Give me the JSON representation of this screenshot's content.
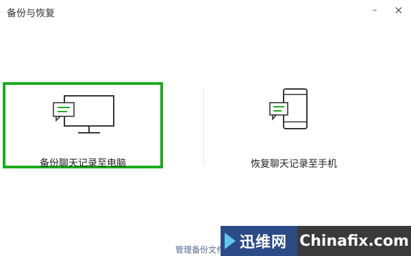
{
  "window": {
    "title": "备份与恢复",
    "minimize_glyph": "–",
    "close_glyph": "×"
  },
  "options": {
    "backup": {
      "label": "备份聊天记录至电脑",
      "icon": "monitor-chat-icon",
      "selected": true
    },
    "restore": {
      "label": "恢复聊天记录至手机",
      "icon": "phone-chat-icon",
      "selected": false
    }
  },
  "footer": {
    "manage_link": "管理备份文件"
  },
  "watermark": {
    "cn_text": "迅维网",
    "en_text": "Chinafix.com"
  },
  "colors": {
    "accent_green": "#1aad19",
    "link_blue": "#576b95",
    "watermark_blue": "#2b4a86",
    "watermark_dark": "#3a3a3a"
  }
}
